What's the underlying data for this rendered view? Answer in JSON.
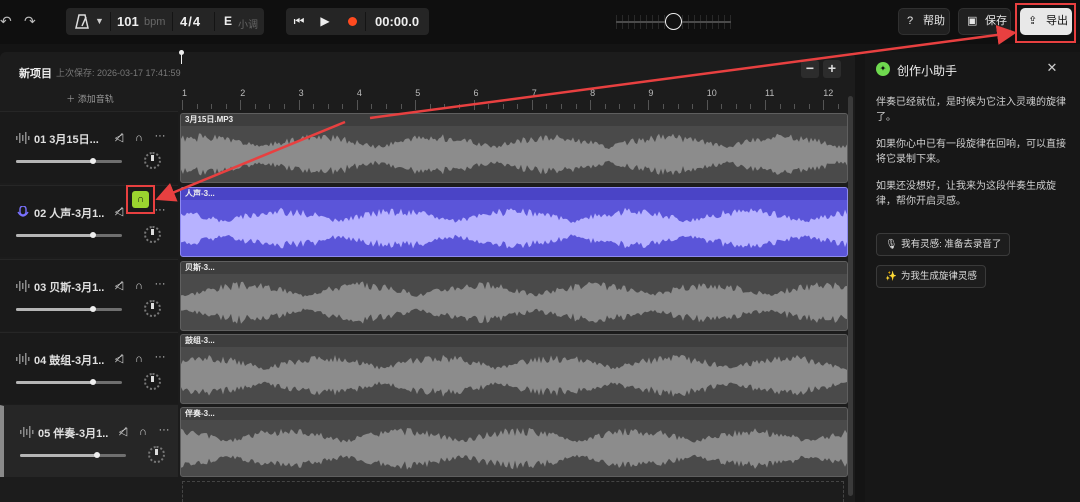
{
  "toolbar": {
    "undo_icon": "↶",
    "redo_icon": "↷",
    "tempo": "101",
    "tempo_unit": "bpm",
    "time_signature": "4/4",
    "key": "E",
    "key_mode": "小调",
    "prev_icon": "⏮",
    "play_icon": "▶",
    "time": "00:00.0",
    "help_label": "帮助",
    "help_icon": "?",
    "save_label": "保存",
    "save_icon": "▣",
    "export_label": "导出",
    "export_icon": "⇪"
  },
  "project": {
    "name": "新项目",
    "last_saved": "上次保存: 2026-03-17 17:41:59",
    "zoom_out": "−",
    "zoom_in": "+"
  },
  "add_track_label": "＋ 添加音轨",
  "ruler": {
    "labels": [
      "1",
      "2",
      "3",
      "4",
      "5",
      "6",
      "7",
      "8",
      "9",
      "10",
      "11",
      "12"
    ]
  },
  "tracks": [
    {
      "name": "01  3月15日...",
      "clip_label": "3月15日.MP3",
      "volume": 0.73,
      "color": "#4a4a4a",
      "kind": "audio"
    },
    {
      "name": "02  人声-3月1...",
      "clip_label": "人声-3...",
      "volume": 0.73,
      "color": "#5b55d9",
      "kind": "vocal"
    },
    {
      "name": "03  贝斯-3月1...",
      "clip_label": "贝斯-3...",
      "volume": 0.73,
      "color": "#4a4a4a",
      "kind": "audio"
    },
    {
      "name": "04  鼓组-3月1...",
      "clip_label": "鼓组-3...",
      "volume": 0.73,
      "color": "#4a4a4a",
      "kind": "audio"
    },
    {
      "name": "05  伴奏-3月1...",
      "clip_label": "伴奏-3...",
      "volume": 0.73,
      "color": "#4a4a4a",
      "kind": "audio"
    }
  ],
  "track_controls": {
    "mute_icon": "🔇",
    "solo_icon": "🎧",
    "more_icon": "···"
  },
  "assistant": {
    "title": "创作小助手",
    "close_icon": "✕",
    "logo_icon": "✦",
    "message1": "伴奏已经就位，是时候为它注入灵魂的旋律了。",
    "message2": "如果你心中已有一段旋律在回响，可以直接将它录制下来。",
    "message3": "如果还没想好，让我来为这段伴奏生成旋律，帮你开启灵感。",
    "chip1": "我有灵感: 准备去录音了",
    "chip1_icon": "🎙",
    "chip2": "为我生成旋律灵感",
    "chip2_icon": "✨"
  },
  "colors": {
    "accent_purple": "#5b55d9",
    "solo_green": "#9bd42f",
    "annotation_red": "#e84040",
    "record_red": "#ff4a1f"
  }
}
